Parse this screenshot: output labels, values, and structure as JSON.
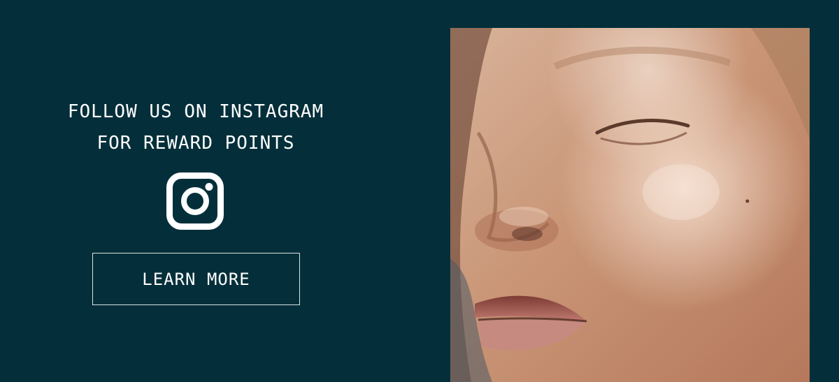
{
  "promo": {
    "headline_line1": "FOLLOW US ON INSTAGRAM",
    "headline_line2": "FOR REWARD POINTS",
    "social_icon": "instagram-icon",
    "cta_label": "LEARN MORE"
  },
  "photo": {
    "subject": "close-up face with closed eyes"
  },
  "colors": {
    "background": "#042f3a",
    "text": "#ffffff",
    "button_border": "#d8e3e5"
  }
}
